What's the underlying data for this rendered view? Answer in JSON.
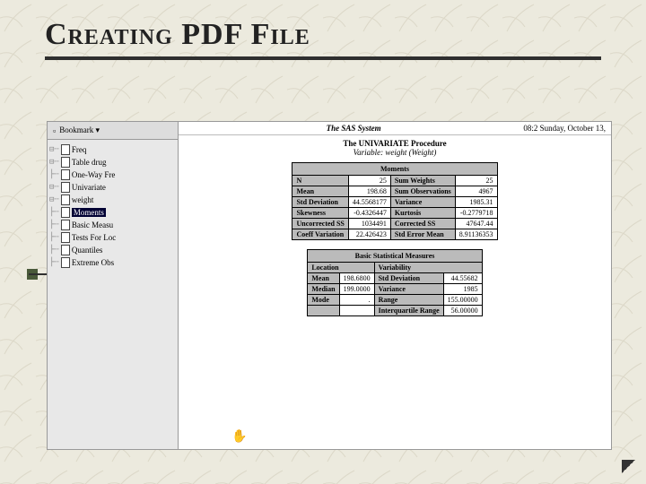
{
  "title": "Creating PDF File",
  "sidebar": {
    "header": "Bookmark ▾",
    "items": [
      {
        "indent": 0,
        "label": "Freq",
        "sel": false
      },
      {
        "indent": 1,
        "label": "Table drug",
        "sel": false
      },
      {
        "indent": 2,
        "label": "One-Way Fre",
        "sel": false
      },
      {
        "indent": 0,
        "label": "Univariate",
        "sel": false
      },
      {
        "indent": 1,
        "label": "weight",
        "sel": false
      },
      {
        "indent": 2,
        "label": "Moments",
        "sel": true
      },
      {
        "indent": 2,
        "label": "Basic Measu",
        "sel": false
      },
      {
        "indent": 2,
        "label": "Tests For Loc",
        "sel": false
      },
      {
        "indent": 2,
        "label": "Quantiles",
        "sel": false
      },
      {
        "indent": 2,
        "label": "Extreme Obs",
        "sel": false
      }
    ]
  },
  "content": {
    "system_title": "The SAS System",
    "timestamp": "08:2  Sunday, October 13,",
    "proc_title": "The UNIVARIATE Procedure",
    "variable_line": "Variable:  weight  (Weight)",
    "moments": {
      "caption": "Moments",
      "rows": [
        [
          "N",
          "25",
          "Sum Weights",
          "25"
        ],
        [
          "Mean",
          "198.68",
          "Sum Observations",
          "4967"
        ],
        [
          "Std Deviation",
          "44.5568177",
          "Variance",
          "1985.31"
        ],
        [
          "Skewness",
          "-0.4326447",
          "Kurtosis",
          "-0.2779718"
        ],
        [
          "Uncorrected SS",
          "1034491",
          "Corrected SS",
          "47647.44"
        ],
        [
          "Coeff Variation",
          "22.426423",
          "Std Error Mean",
          "8.91136353"
        ]
      ]
    },
    "basic": {
      "caption": "Basic Statistical Measures",
      "headers": [
        "Location",
        "Variability"
      ],
      "rows": [
        [
          "Mean",
          "198.6800",
          "Std Deviation",
          "44.55682"
        ],
        [
          "Median",
          "199.0000",
          "Variance",
          "1985"
        ],
        [
          "Mode",
          ".",
          "Range",
          "155.00000"
        ],
        [
          "",
          "",
          "Interquartile Range",
          "56.00000"
        ]
      ]
    }
  },
  "hand": "✋"
}
